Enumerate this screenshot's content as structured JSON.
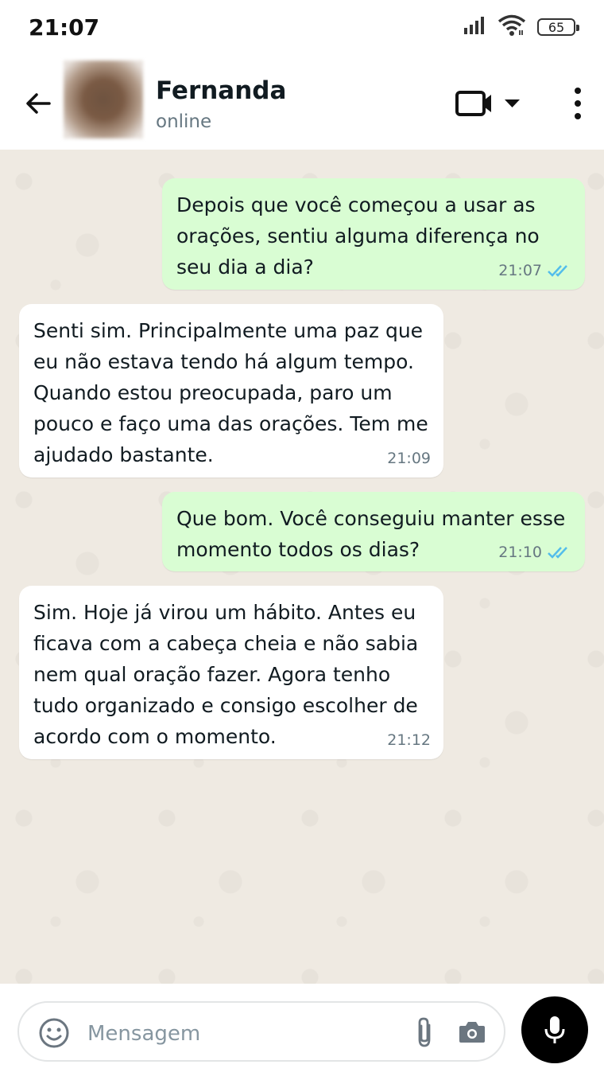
{
  "status_bar": {
    "time": "21:07",
    "battery": "65"
  },
  "header": {
    "name": "Fernanda",
    "status": "online"
  },
  "messages": [
    {
      "direction": "outgoing",
      "text": "Depois que você começou a usar as orações, sentiu alguma diferença no seu dia a dia?",
      "time": "21:07",
      "read": true
    },
    {
      "direction": "incoming",
      "text": "Senti sim. Principalmente uma paz que eu não estava tendo há algum tempo. Quando estou preocupada, paro um pouco e faço uma das orações. Tem me ajudado bastante.",
      "time": "21:09"
    },
    {
      "direction": "outgoing",
      "text": "Que bom. Você conseguiu manter esse momento todos os dias?",
      "time": "21:10",
      "read": true
    },
    {
      "direction": "incoming",
      "text": "Sim. Hoje já virou um hábito. Antes eu ficava com a cabeça cheia e não sabia nem qual oração fazer. Agora tenho tudo organizado e consigo escolher de acordo com o momento.",
      "time": "21:12"
    }
  ],
  "composer": {
    "placeholder": "Mensagem"
  },
  "colors": {
    "outgoing_bubble": "#d9fdd3",
    "incoming_bubble": "#ffffff",
    "read_ticks": "#53bdeb",
    "chat_background": "#efeae2",
    "mic_button": "#000000"
  },
  "icons": [
    "signal-icon",
    "wifi-icon",
    "battery-icon",
    "back-arrow-icon",
    "video-call-icon",
    "dropdown-caret-icon",
    "more-vert-icon",
    "double-check-icon",
    "emoji-icon",
    "attach-icon",
    "camera-icon",
    "mic-icon"
  ]
}
